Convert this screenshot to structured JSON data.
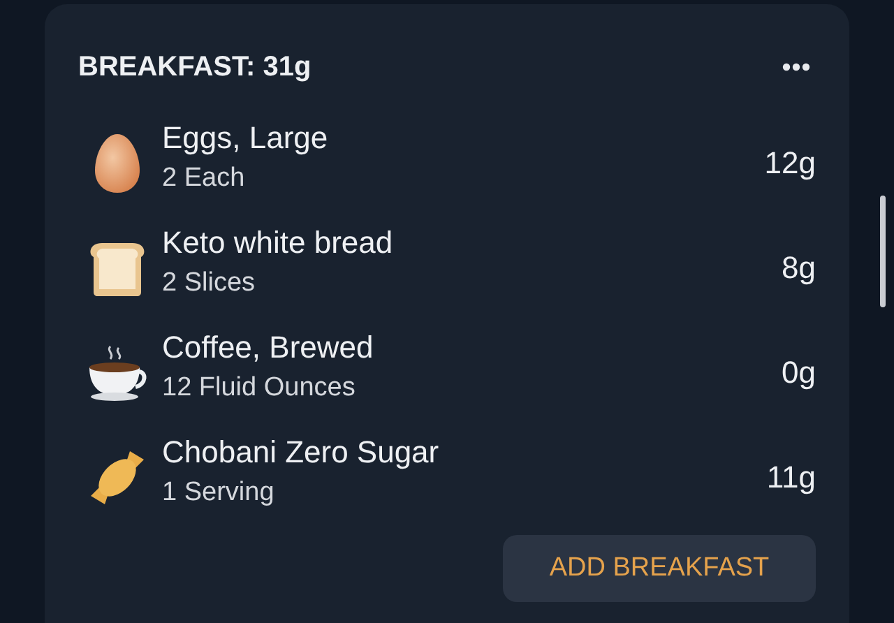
{
  "meal": {
    "title": "BREAKFAST: 31g",
    "items": [
      {
        "kind": "egg",
        "name": "Eggs, Large",
        "amount": "2 Each",
        "value": "12g"
      },
      {
        "kind": "bread",
        "name": "Keto white bread",
        "amount": "2 Slices",
        "value": "8g"
      },
      {
        "kind": "coffee",
        "name": "Coffee, Brewed",
        "amount": "12 Fluid Ounces",
        "value": "0g"
      },
      {
        "kind": "candy",
        "name": "Chobani Zero Sugar",
        "amount": "1 Serving",
        "value": "11g"
      }
    ],
    "button": "ADD BREAKFAST"
  }
}
